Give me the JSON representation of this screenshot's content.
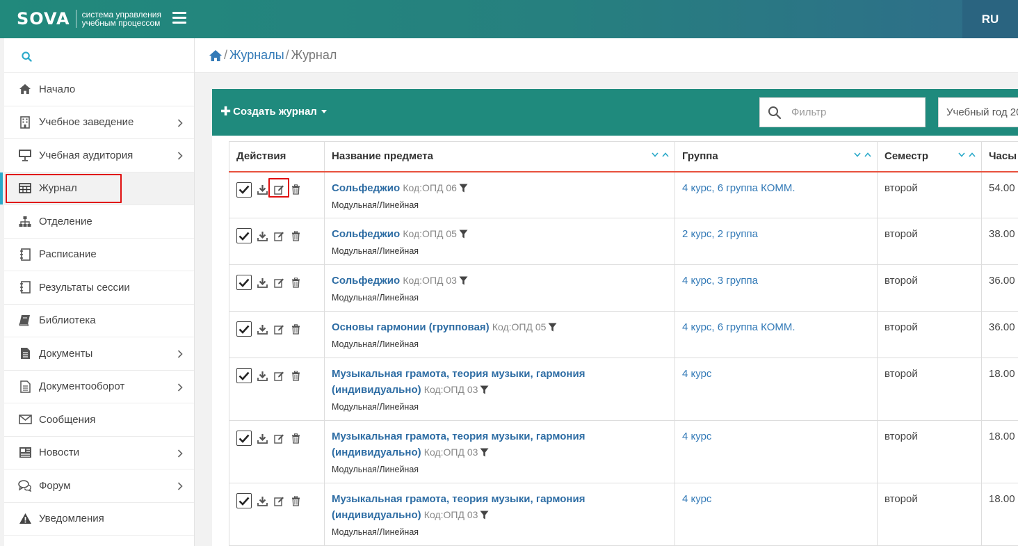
{
  "header": {
    "logo_text": "SOVA",
    "logo_tagline": "система управления учебным процессом",
    "lang": "RU"
  },
  "sidebar": {
    "items": [
      {
        "label": "Начало",
        "icon": "home-icon",
        "arrow": false
      },
      {
        "label": "Учебное заведение",
        "icon": "building-icon",
        "arrow": true
      },
      {
        "label": "Учебная аудитория",
        "icon": "presentation-board-icon",
        "arrow": true
      },
      {
        "label": "Журнал",
        "icon": "table-icon",
        "arrow": false,
        "active": true
      },
      {
        "label": "Отделение",
        "icon": "sitemap-icon",
        "arrow": false
      },
      {
        "label": "Расписание",
        "icon": "notebook-icon",
        "arrow": false
      },
      {
        "label": "Результаты сессии",
        "icon": "notebook-icon",
        "arrow": false
      },
      {
        "label": "Библиотека",
        "icon": "book-icon",
        "arrow": false
      },
      {
        "label": "Документы",
        "icon": "document-icon",
        "arrow": true
      },
      {
        "label": "Документооборот",
        "icon": "document-outline-icon",
        "arrow": true
      },
      {
        "label": "Сообщения",
        "icon": "envelope-icon",
        "arrow": false
      },
      {
        "label": "Новости",
        "icon": "newspaper-icon",
        "arrow": true
      },
      {
        "label": "Форум",
        "icon": "chat-bubbles-icon",
        "arrow": true
      },
      {
        "label": "Уведомления",
        "icon": "warning-icon",
        "arrow": false
      }
    ]
  },
  "breadcrumb": {
    "sep": "/",
    "journals": "Журналы",
    "current": "Журнал"
  },
  "toolbar": {
    "create_label": "Создать журнал",
    "filter_placeholder": "Фильтр",
    "year_label": "Учебный год 20"
  },
  "table": {
    "headers": [
      "Действия",
      "Название предмета",
      "Группа",
      "Семестр",
      "Часы"
    ],
    "rows": [
      {
        "subject": "Сольфеджио",
        "code": "Код:ОПД 06",
        "mode": "Модульная/Линейная",
        "group": "4 курс, 6 группа КОММ.",
        "semester": "второй",
        "hours": "54.00"
      },
      {
        "subject": "Сольфеджио",
        "code": "Код:ОПД 05",
        "mode": "Модульная/Линейная",
        "group": "2 курс, 2 группа",
        "semester": "второй",
        "hours": "38.00"
      },
      {
        "subject": "Сольфеджио",
        "code": "Код:ОПД 03",
        "mode": "Модульная/Линейная",
        "group": "4 курс, 3 группа",
        "semester": "второй",
        "hours": "36.00"
      },
      {
        "subject": "Основы гармонии (групповая)",
        "code": "Код:ОПД 05",
        "mode": "Модульная/Линейная",
        "group": "4 курс, 6 группа КОММ.",
        "semester": "второй",
        "hours": "36.00"
      },
      {
        "subject": "Музыкальная грамота, теория музыки, гармония (индивидуально)",
        "code": "Код:ОПД 03",
        "mode": "Модульная/Линейная",
        "group": "4 курс",
        "semester": "второй",
        "hours": "18.00"
      },
      {
        "subject": "Музыкальная грамота, теория музыки, гармония (индивидуально)",
        "code": "Код:ОПД 03",
        "mode": "Модульная/Линейная",
        "group": "4 курс",
        "semester": "второй",
        "hours": "18.00"
      },
      {
        "subject": "Музыкальная грамота, теория музыки, гармония (индивидуально)",
        "code": "Код:ОПД 03",
        "mode": "Модульная/Линейная",
        "group": "4 курс",
        "semester": "второй",
        "hours": "18.00"
      }
    ]
  },
  "colors": {
    "header_teal": "#21897c",
    "panel_teal": "#1f8a7d",
    "link_blue": "#2e6da4",
    "header_underline": "#e8513d",
    "highlight_red": "#e01010"
  }
}
